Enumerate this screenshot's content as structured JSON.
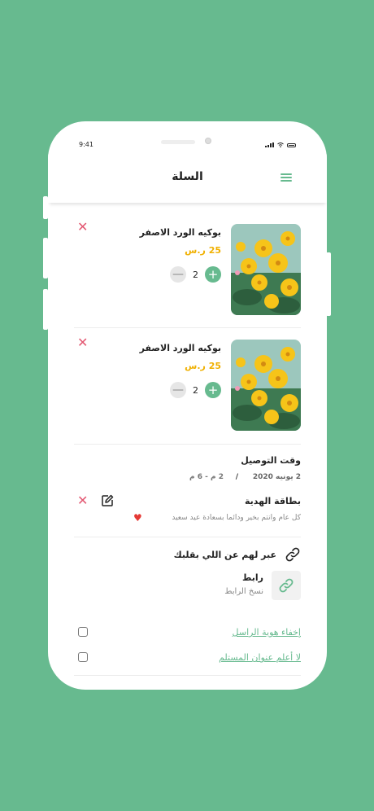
{
  "status_bar": {
    "time": "9:41"
  },
  "header": {
    "title": "السلة"
  },
  "cart": {
    "items": [
      {
        "name": "بوكيه الورد الاصفر",
        "price": "25 ر.س",
        "quantity": "2"
      },
      {
        "name": "بوكيه الورد الاصفر",
        "price": "25 ر.س",
        "quantity": "2"
      }
    ]
  },
  "delivery": {
    "title": "وقت التوصيل",
    "date": "2 يونيه 2020",
    "separator": "/",
    "time": "2 م - 6 م"
  },
  "gift_card": {
    "title": "بطاقة الهدية",
    "message": "كل عام وانتم بخير ودائما بسعادة عيد سعيد"
  },
  "express": {
    "title": "عبر لهم عن اللي بقلبك",
    "link_title": "رابط",
    "link_action": "نسخ الرابط"
  },
  "options": [
    {
      "label": "إخفاء هوية الراسل",
      "checked": false
    },
    {
      "label": "لا أعلم عنوان المستلم",
      "checked": false
    }
  ],
  "colors": {
    "brand": "#67ba8f",
    "price": "#f0b000",
    "remove": "#e35872"
  }
}
